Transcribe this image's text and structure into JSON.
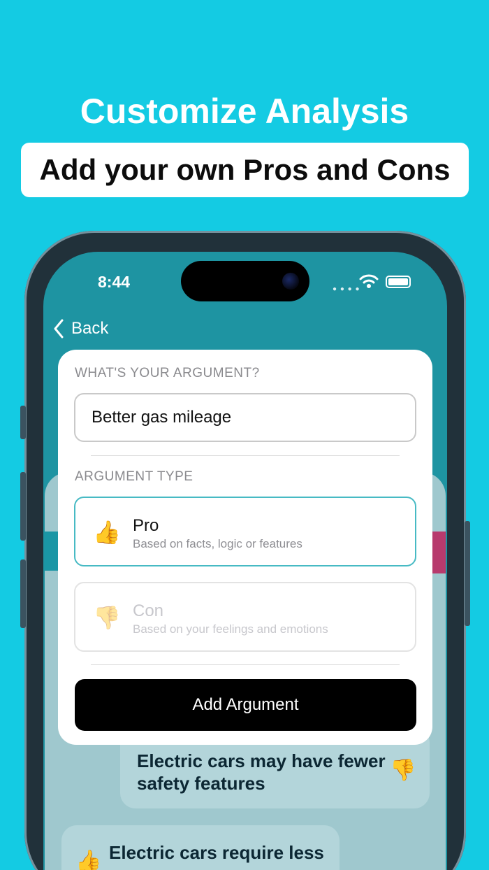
{
  "promo": {
    "headline": "Customize Analysis",
    "subheadline": "Add your own Pros and Cons"
  },
  "status_bar": {
    "time": "8:44",
    "icons": [
      "wifi-icon",
      "battery-icon"
    ]
  },
  "nav": {
    "back_label": "Back"
  },
  "modal": {
    "argument_label": "WHAT'S YOUR ARGUMENT?",
    "argument_value": "Better gas mileage",
    "type_label": "ARGUMENT TYPE",
    "options": [
      {
        "emoji": "👍",
        "title": "Pro",
        "subtitle": "Based on facts, logic or features",
        "selected": true
      },
      {
        "emoji": "👎",
        "title": "Con",
        "subtitle": "Based on your feelings and emotions",
        "selected": false
      }
    ],
    "submit_label": "Add Argument"
  },
  "background_cards": [
    {
      "text": "Electric cars may have fewer safety features",
      "emoji": "👎"
    },
    {
      "text": "Electric cars require less",
      "emoji": "👍"
    }
  ],
  "colors": {
    "page_bg": "#14CBE3",
    "screen_bg": "#1E94A2",
    "selected_border": "#47BAC4",
    "button_bg": "#000000"
  }
}
